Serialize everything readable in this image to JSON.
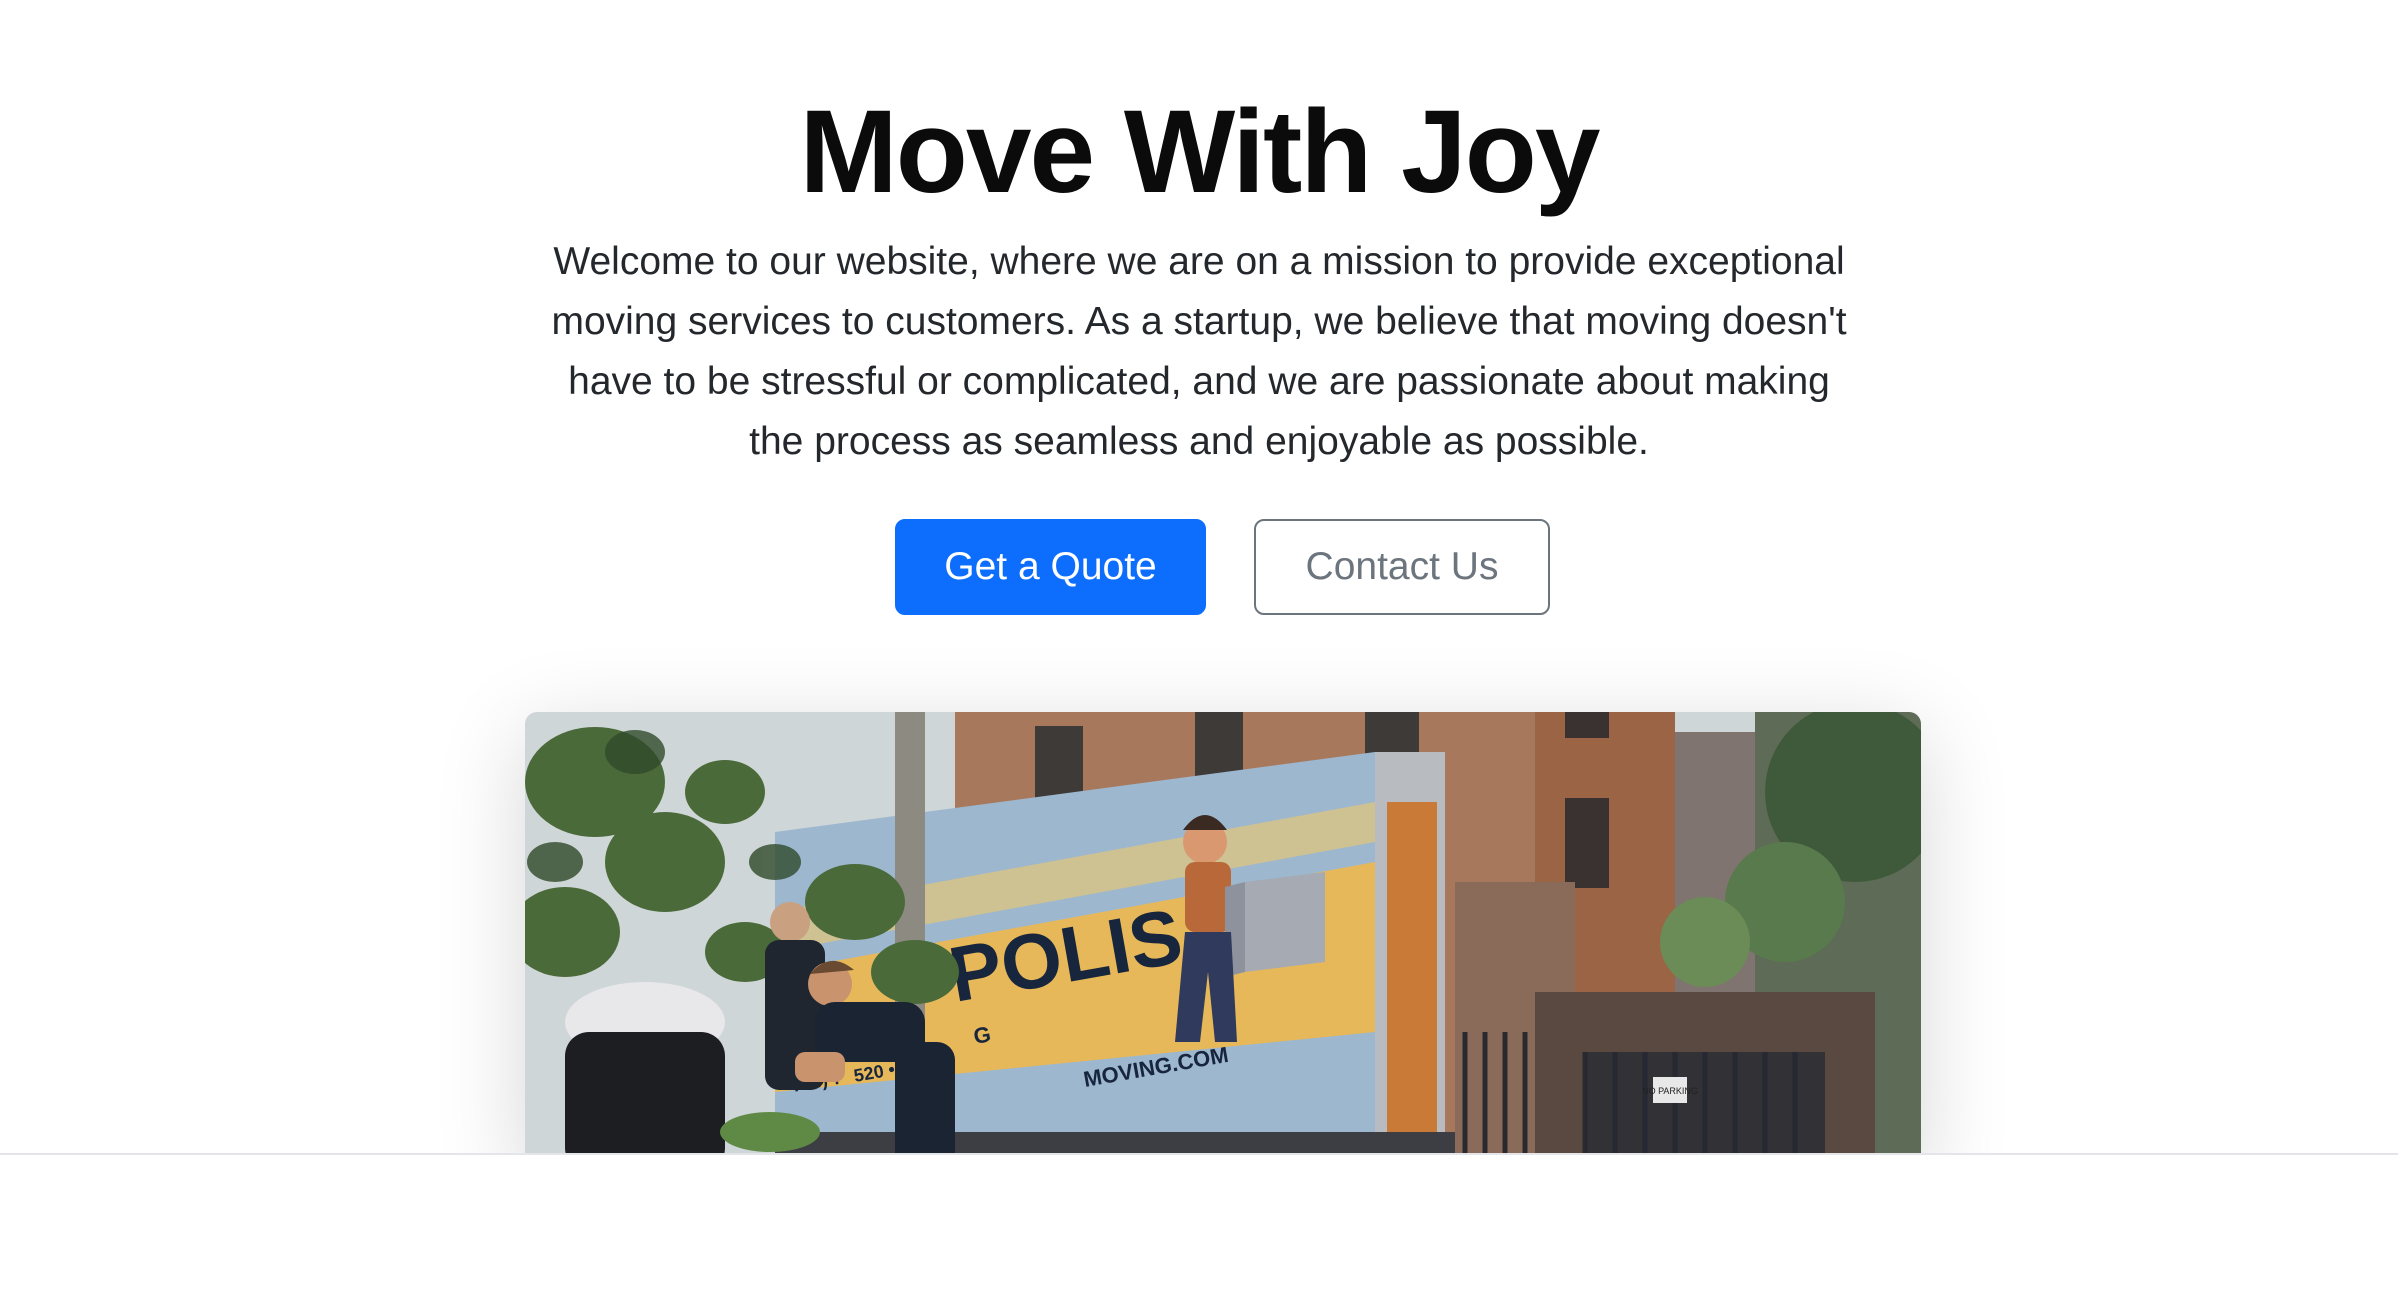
{
  "hero": {
    "title": "Move With Joy",
    "lead": "Welcome to our website, where we are on a mission to provide exceptional moving services to customers. As a startup, we believe that moving doesn't have to be stressful or complicated, and we are passionate about making the process as seamless and enjoyable as possible.",
    "primary_button": "Get a Quote",
    "secondary_button": "Contact Us"
  },
  "image": {
    "truck_text": "POLIS",
    "truck_sub": "G",
    "truck_phone": "718) 7",
    "truck_phone2": "520 •",
    "truck_url": "MOVING.COM",
    "sign_text": "NO PARKING"
  },
  "colors": {
    "primary": "#0d6efd",
    "secondary": "#6c757d",
    "title": "#0b0b0b"
  }
}
